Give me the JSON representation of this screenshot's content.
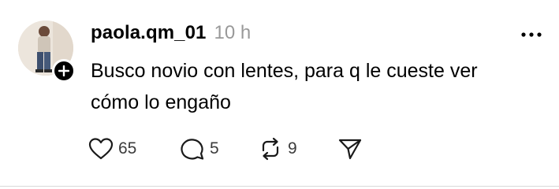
{
  "post": {
    "username": "paola.qm_01",
    "timestamp": "10 h",
    "text_line1": "Busco novio con lentes, para q le cueste ver",
    "text_line2": "cómo lo engaño",
    "likes": "65",
    "replies": "5",
    "reposts": "9"
  },
  "icons": {
    "follow": "plus-icon",
    "more": "more-horizontal-icon",
    "like": "heart-icon",
    "reply": "comment-icon",
    "repost": "repost-icon",
    "share": "send-icon"
  },
  "colors": {
    "timestamp": "#999999",
    "count": "#3b3b3b",
    "divider": "#d9d9d9"
  }
}
